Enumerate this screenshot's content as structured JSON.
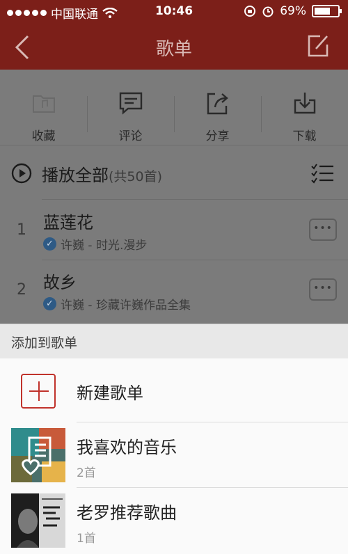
{
  "status_bar": {
    "carrier": "中国联通",
    "time": "10:46",
    "battery": "69%",
    "battery_level": 0.69
  },
  "nav": {
    "title": "歌单",
    "back_icon": "chevron-left-icon",
    "edit_icon": "edit-icon"
  },
  "actions": [
    {
      "label": "收藏",
      "icon": "folder-music-icon"
    },
    {
      "label": "评论",
      "icon": "comment-icon"
    },
    {
      "label": "分享",
      "icon": "share-icon"
    },
    {
      "label": "下载",
      "icon": "download-icon"
    }
  ],
  "play_all": {
    "label": "播放全部",
    "count": "(共50首)"
  },
  "songs": [
    {
      "index": "1",
      "name": "蓝莲花",
      "artist_album": "许巍 - 时光.漫步"
    },
    {
      "index": "2",
      "name": "故乡",
      "artist_album": "许巍 - 珍藏许巍作品全集"
    }
  ],
  "sheet": {
    "title": "添加到歌单",
    "new_playlist": "新建歌单",
    "playlists": [
      {
        "name": "我喜欢的音乐",
        "count": "2首"
      },
      {
        "name": "老罗推荐歌曲",
        "count": "1首"
      }
    ]
  },
  "colors": {
    "nav_bg": "#7c1f19",
    "accent": "#c0322b"
  }
}
